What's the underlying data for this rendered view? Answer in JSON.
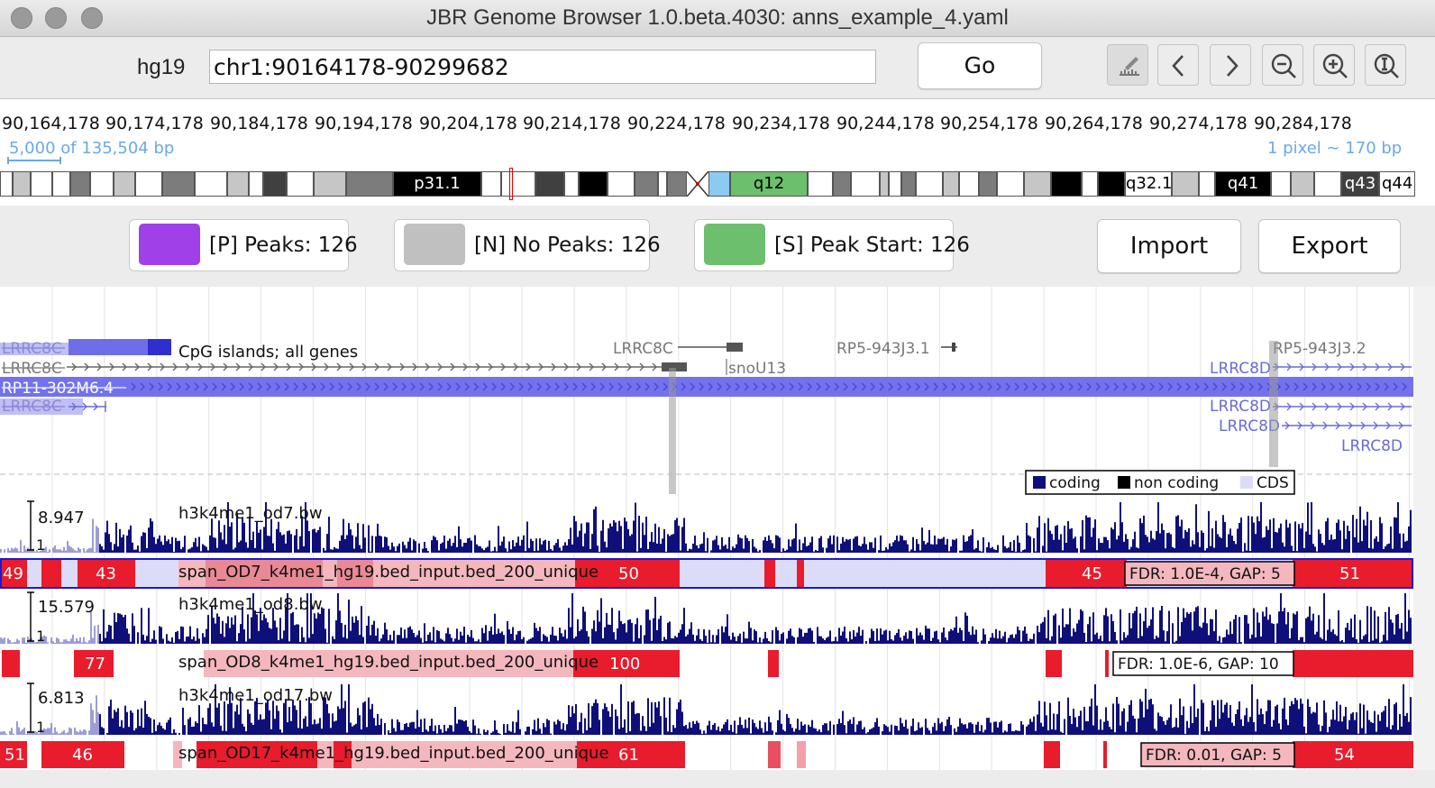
{
  "window": {
    "title": "JBR Genome Browser 1.0.beta.4030: anns_example_4.yaml"
  },
  "toolbar": {
    "genome": "hg19",
    "location": "chr1:90164178-90299682",
    "go_label": "Go"
  },
  "ruler": {
    "ticks": [
      "90,164,178",
      "90,174,178",
      "90,184,178",
      "90,194,178",
      "90,204,178",
      "90,214,178",
      "90,224,178",
      "90,234,178",
      "90,244,178",
      "90,254,178",
      "90,264,178",
      "90,274,178",
      "90,284,178"
    ],
    "scale_left": "5,000 of 135,504 bp",
    "scale_right": "1 pixel ~ 170 bp",
    "band_labels": [
      "p31.1",
      "q12",
      "q32.1",
      "q41",
      "q43",
      "q44"
    ]
  },
  "legend": {
    "peaks": {
      "label": "[P] Peaks: 126",
      "color": "#a040e8"
    },
    "nopeaks": {
      "label": "[N] No Peaks: 126",
      "color": "#c0c0c0"
    },
    "peakstart": {
      "label": "[S] Peak Start: 126",
      "color": "#6cbf6c"
    },
    "import_label": "Import",
    "export_label": "Export"
  },
  "genes": {
    "labels": [
      "LRRC8C",
      "CpG islands; all genes",
      "LRRC8C",
      "RP11-302M6.4",
      "LRRC8C",
      "LRRC8C",
      "snoU13",
      "RP5-943J3.1",
      "RP5-943J3.2",
      "LRRC8D",
      "LRRC8D",
      "LRRC8D",
      "LRRC8D"
    ],
    "legend": [
      "coding",
      "non coding",
      "CDS"
    ]
  },
  "tracks": [
    {
      "name": "h3k4me1_od7.bw",
      "max": "8.947",
      "min": "1"
    },
    {
      "name": "span_OD7_k4me1_hg19.bed_input.bed_200_unique",
      "fdr": "FDR: 1.0E-4, GAP: 5",
      "counts": [
        "49",
        "43",
        "50",
        "45",
        "51"
      ]
    },
    {
      "name": "h3k4me1_od8.bw",
      "max": "15.579",
      "min": "1"
    },
    {
      "name": "span_OD8_k4me1_hg19.bed_input.bed_200_unique",
      "fdr": "FDR: 1.0E-6, GAP: 10",
      "counts": [
        "77",
        "100"
      ]
    },
    {
      "name": "h3k4me1_od17.bw",
      "max": "6.813",
      "min": "1"
    },
    {
      "name": "span_OD17_k4me1_hg19.bed_input.bed_200_unique",
      "fdr": "FDR: 0.01, GAP: 5",
      "counts": [
        "51",
        "46",
        "61",
        "54"
      ]
    }
  ],
  "colors": {
    "coverage": "#0f0f7a",
    "peak": "#e81c2c",
    "peak_light": "#f7a3a8",
    "selected_bg": "#dcdcf8",
    "selection_border": "#1a1ad0"
  }
}
